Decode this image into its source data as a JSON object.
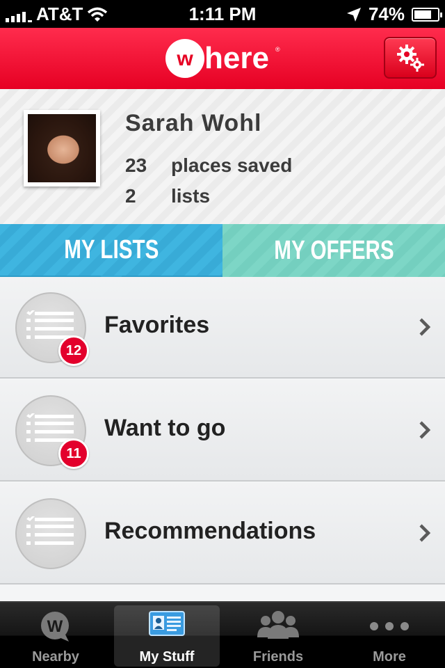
{
  "status_bar": {
    "carrier": "AT&T",
    "time": "1:11 PM",
    "battery": "74%",
    "battery_level": 0.74
  },
  "header": {
    "logo_text": "where",
    "logo_mark": "®",
    "settings_icon": "gears-icon"
  },
  "profile": {
    "name": "Sarah Wohl",
    "places_count": "23",
    "places_label": "places saved",
    "lists_count": "2",
    "lists_label": "lists"
  },
  "tabs": [
    {
      "label": "MY LISTS",
      "active": true
    },
    {
      "label": "MY OFFERS",
      "active": false
    }
  ],
  "lists": [
    {
      "label": "Favorites",
      "badge": "12"
    },
    {
      "label": "Want to go",
      "badge": "11"
    },
    {
      "label": "Recommendations",
      "badge": null
    }
  ],
  "tabbar": [
    {
      "label": "Nearby",
      "icon": "where-w-icon",
      "active": false
    },
    {
      "label": "My Stuff",
      "icon": "id-card-icon",
      "active": true
    },
    {
      "label": "Friends",
      "icon": "friends-icon",
      "active": false
    },
    {
      "label": "More",
      "icon": "more-dots-icon",
      "active": false
    }
  ],
  "colors": {
    "brand_red": "#e60023",
    "tab_blue": "#3fb5e0",
    "tab_teal": "#7dd6c6",
    "badge_red": "#e3002c"
  }
}
